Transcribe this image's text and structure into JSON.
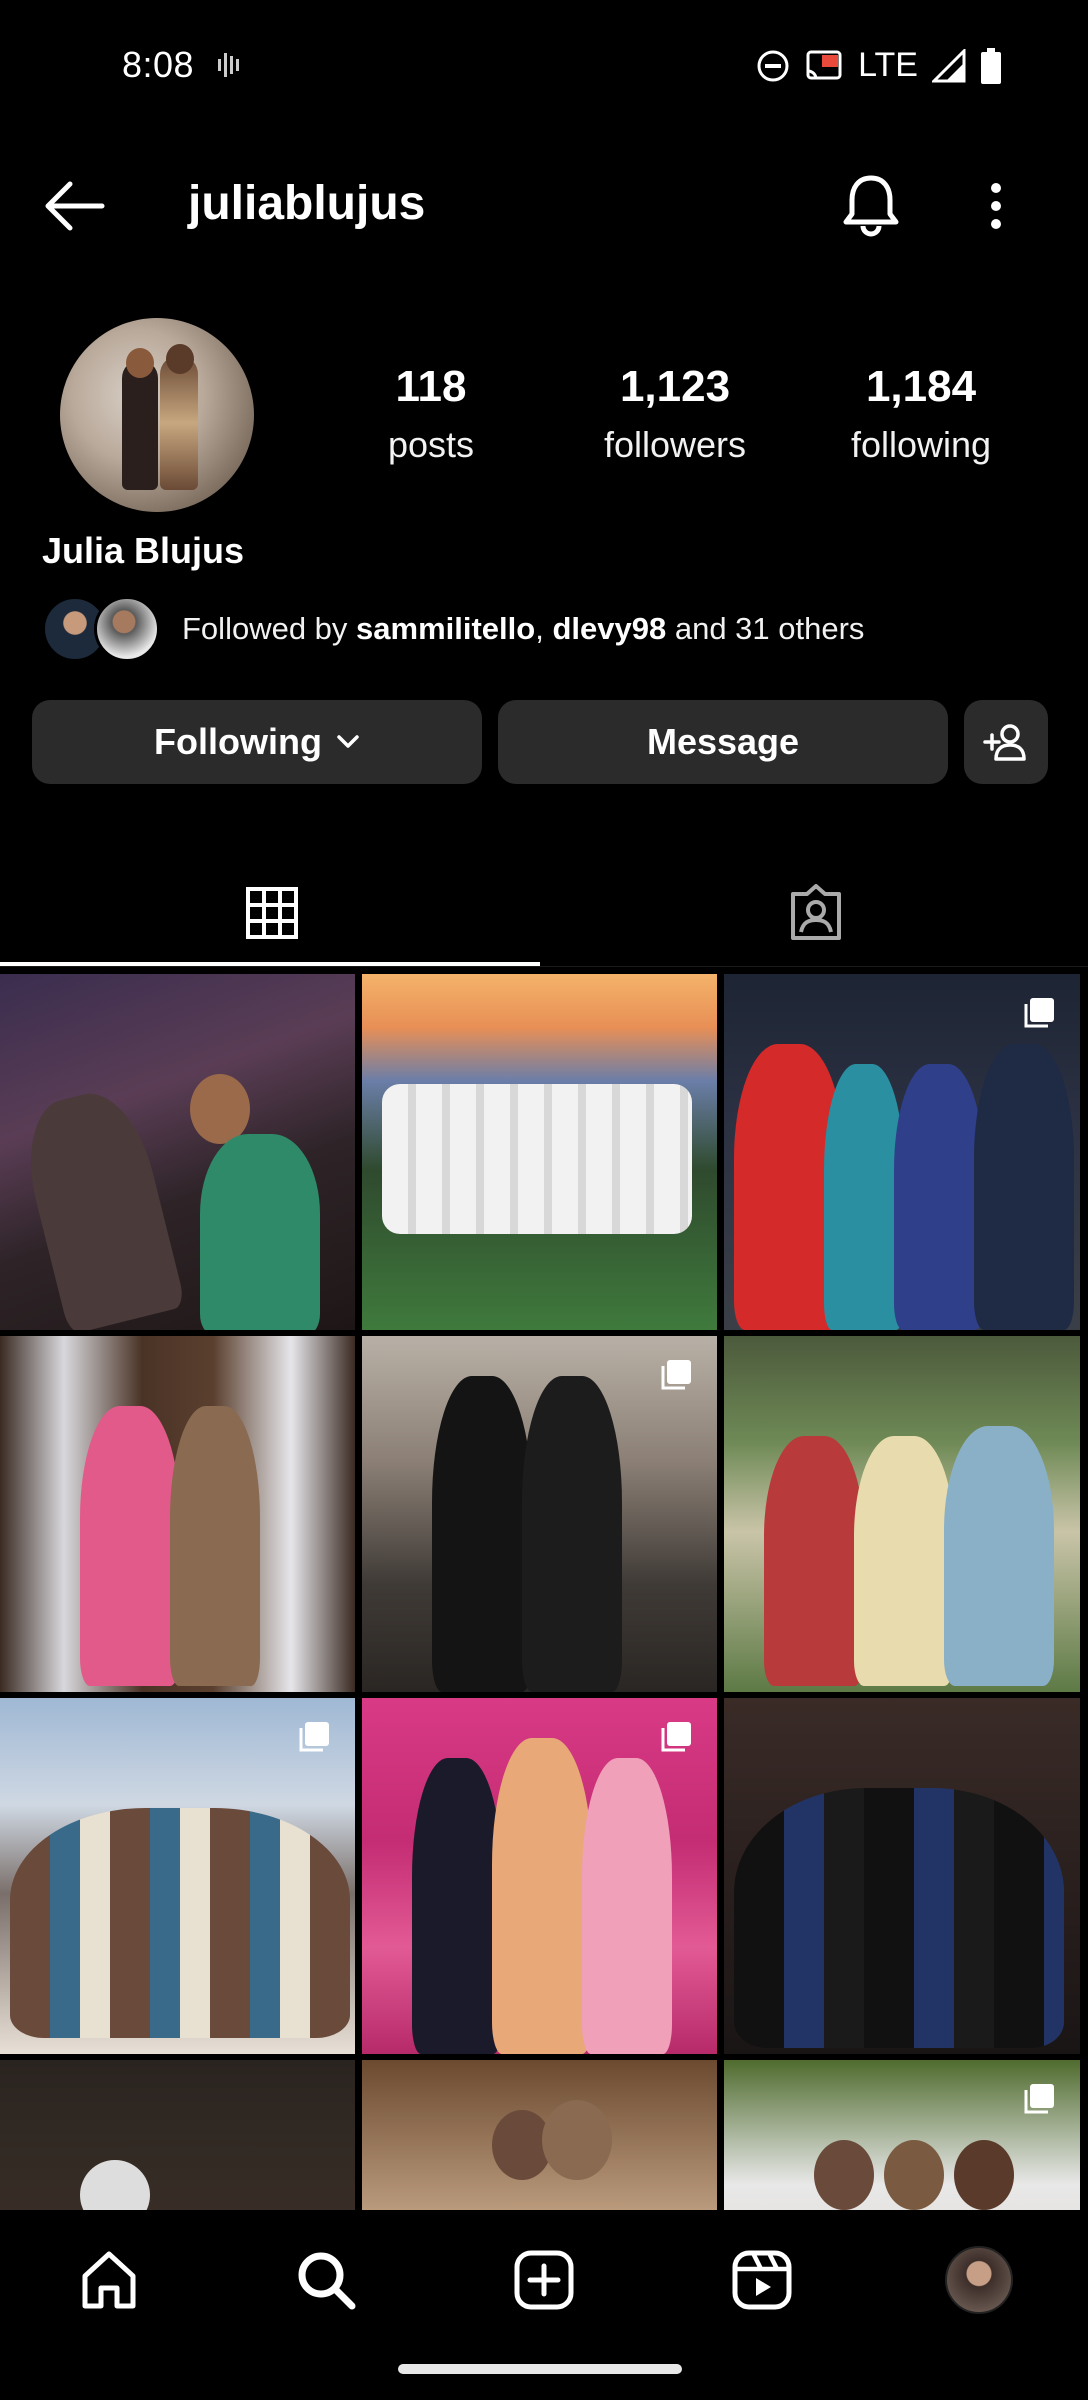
{
  "status_bar": {
    "time": "8:08",
    "network": "LTE",
    "icons": [
      "vibrate-icon",
      "do-not-disturb-icon",
      "cast-icon",
      "signal-icon",
      "battery-icon"
    ]
  },
  "header": {
    "username": "juliablujus",
    "icons": [
      "back-arrow-icon",
      "bell-icon",
      "more-vertical-icon"
    ]
  },
  "profile": {
    "full_name": "Julia Blujus",
    "stats": {
      "posts": {
        "value": "118",
        "label": "posts"
      },
      "followers": {
        "value": "1,123",
        "label": "followers"
      },
      "following": {
        "value": "1,184",
        "label": "following"
      }
    },
    "followed_by": {
      "prefix": "Followed by ",
      "user1": "sammilitello",
      "separator": ", ",
      "user2": "dlevy98",
      "suffix": " and 31 others"
    }
  },
  "actions": {
    "following_label": "Following",
    "message_label": "Message"
  },
  "tabs": [
    {
      "name": "grid",
      "icon": "grid-icon",
      "active": true
    },
    {
      "name": "tagged",
      "icon": "tagged-icon",
      "active": false
    }
  ],
  "grid": {
    "posts": [
      {
        "id": "post-1",
        "multi": false
      },
      {
        "id": "post-2",
        "multi": false
      },
      {
        "id": "post-3",
        "multi": true
      },
      {
        "id": "post-4",
        "multi": false
      },
      {
        "id": "post-5",
        "multi": true
      },
      {
        "id": "post-6",
        "multi": false
      },
      {
        "id": "post-7",
        "multi": true
      },
      {
        "id": "post-8",
        "multi": true
      },
      {
        "id": "post-9",
        "multi": false
      },
      {
        "id": "post-10",
        "multi": false
      },
      {
        "id": "post-11",
        "multi": false
      },
      {
        "id": "post-12",
        "multi": true
      }
    ]
  },
  "bottom_nav": {
    "items": [
      "home-icon",
      "search-icon",
      "create-icon",
      "reels-icon",
      "profile-avatar"
    ],
    "active": "search-icon"
  },
  "colors": {
    "background": "#000000",
    "button_bg": "#2b2b2b",
    "text": "#ffffff"
  }
}
